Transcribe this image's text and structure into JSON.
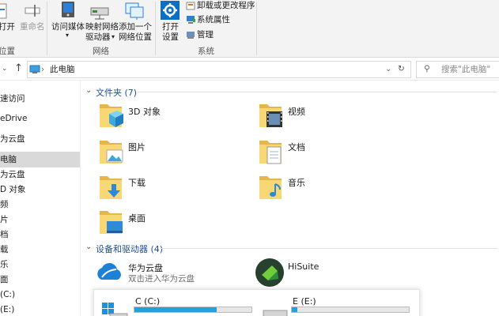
{
  "ribbon": {
    "open_cut": "打开",
    "rename": "重命名",
    "location_group_cut": "位置",
    "access_media": "访问媒体",
    "map_drive_line1": "映射网络",
    "map_drive_line2": "驱动器",
    "add_location_line1": "添加一个",
    "add_location_line2": "网络位置",
    "network_group": "网络",
    "open_settings_line1": "打开",
    "open_settings_line2": "设置",
    "uninstall": "卸载或更改程序",
    "system_properties": "系统属性",
    "manage": "管理",
    "system_group": "系统"
  },
  "address": {
    "path": "此电脑",
    "search_placeholder": "搜索\"此电脑\""
  },
  "nav": {
    "items": [
      {
        "label": "速访问"
      },
      {
        "label": "eDrive"
      },
      {
        "label": "为云盘"
      },
      {
        "label": "电脑"
      },
      {
        "label": "为云盘"
      },
      {
        "label": "D 对象"
      },
      {
        "label": "频"
      },
      {
        "label": "片"
      },
      {
        "label": "档"
      },
      {
        "label": "载"
      },
      {
        "label": "乐"
      },
      {
        "label": "面"
      },
      {
        "label": "(C:)"
      },
      {
        "label": "(E:)"
      }
    ]
  },
  "folders_section": {
    "title": "文件夹 (7)",
    "items": [
      {
        "label": "3D 对象"
      },
      {
        "label": "视频"
      },
      {
        "label": "图片"
      },
      {
        "label": "文档"
      },
      {
        "label": "下载"
      },
      {
        "label": "音乐"
      },
      {
        "label": "桌面"
      }
    ]
  },
  "devices_section": {
    "title": "设备和驱动器 (4)",
    "huawei": {
      "name": "华为云盘",
      "sub": "双击进入华为云盘"
    },
    "hisuite": {
      "name": "HiSuite"
    },
    "drives": [
      {
        "label": "C (C:)",
        "used": 0.7
      },
      {
        "label": "E (E:)",
        "used": 0.05
      }
    ]
  },
  "colors": {
    "accent": "#0078d7",
    "section_title": "#1e4e99",
    "folder": "#f8d775",
    "drive_bar": "#26a0da"
  }
}
